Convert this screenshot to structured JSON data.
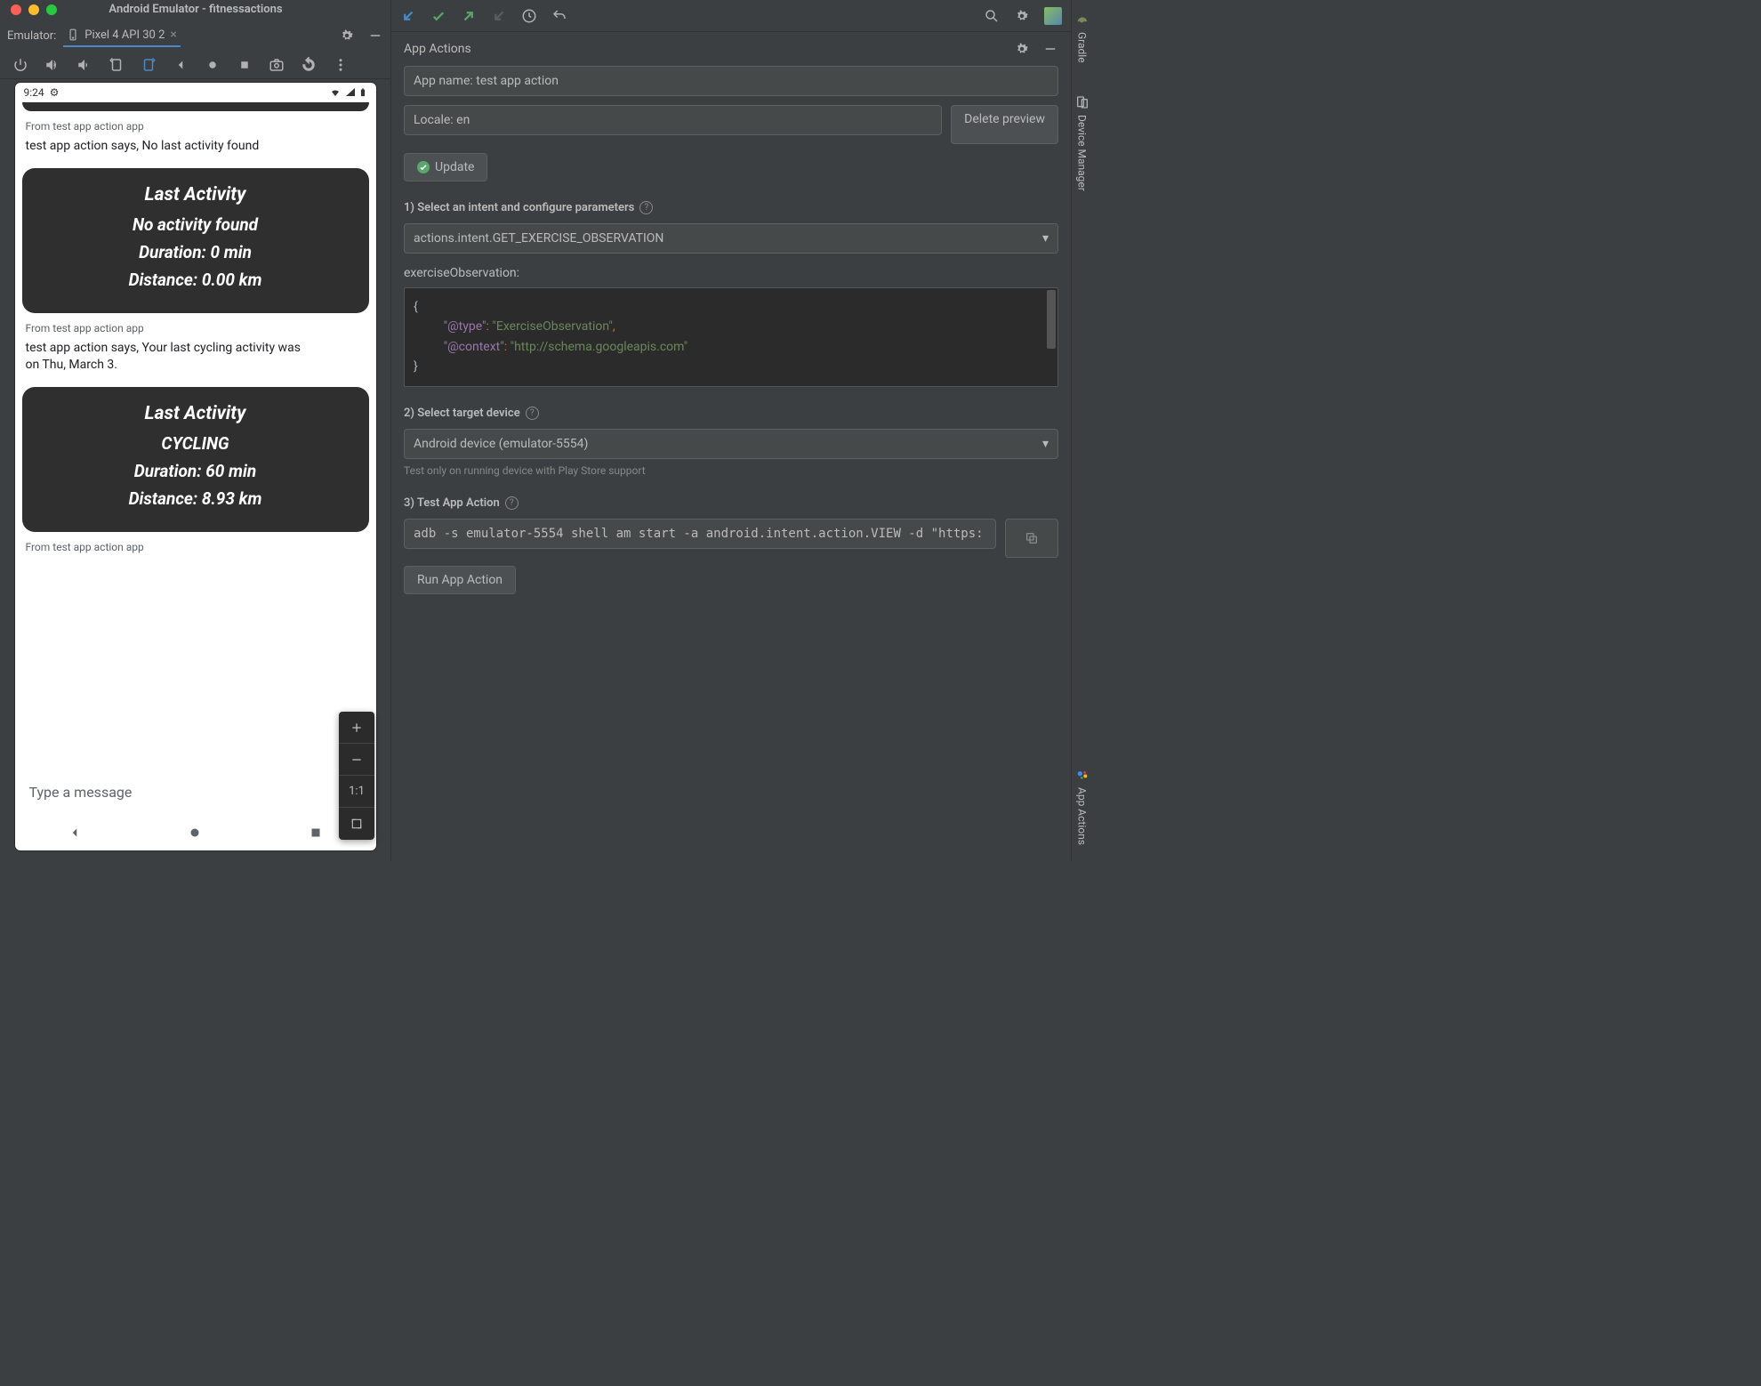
{
  "window": {
    "title": "Android Emulator - fitnessactions"
  },
  "emulator": {
    "label": "Emulator:",
    "tab": "Pixel 4 API 30 2"
  },
  "phone": {
    "time": "9:24",
    "caption": "From test app action app",
    "message1": "test app action says, No last activity found",
    "card1": {
      "title": "Last Activity",
      "line1": "No activity found",
      "line2": "Duration: 0 min",
      "line3": "Distance: 0.00 km"
    },
    "message2": "test app action says, Your last cycling activity was on Thu, March 3.",
    "card2": {
      "title": "Last Activity",
      "line1": "CYCLING",
      "line2": "Duration: 60 min",
      "line3": "Distance: 8.93 km"
    },
    "input_placeholder": "Type a message",
    "zoom": {
      "one_to_one": "1:1"
    }
  },
  "panel": {
    "title": "App Actions",
    "app_name": "App name: test app action",
    "locale": "Locale: en",
    "delete_preview": "Delete preview",
    "update": "Update",
    "step1": "1) Select an intent and configure parameters",
    "intent": "actions.intent.GET_EXERCISE_OBSERVATION",
    "param_label": "exerciseObservation:",
    "json": {
      "open": "{",
      "k1": "\"@type\"",
      "v1": "\"ExerciseObservation\"",
      "k2": "\"@context\"",
      "v2": "\"http://schema.googleapis.com\"",
      "close": "}"
    },
    "step2": "2) Select target device",
    "device": "Android device (emulator-5554)",
    "device_hint": "Test only on running device with Play Store support",
    "step3": "3) Test App Action",
    "adb": "adb -s emulator-5554 shell am start -a android.intent.action.VIEW -d \"https:",
    "run": "Run App Action"
  },
  "rail": {
    "gradle": "Gradle",
    "device_manager": "Device Manager",
    "app_actions": "App Actions"
  }
}
